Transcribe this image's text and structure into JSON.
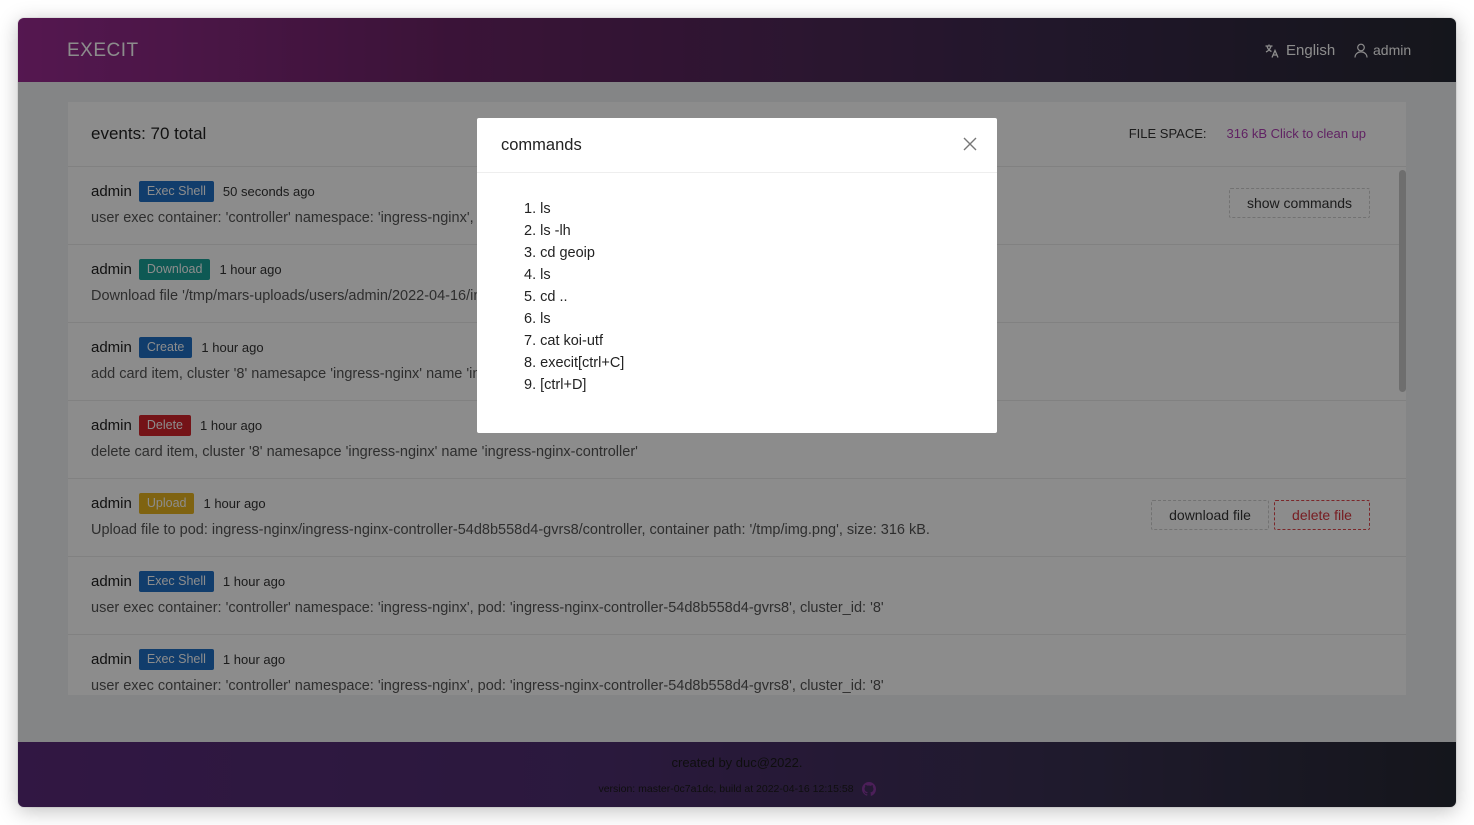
{
  "header": {
    "logo": "EXECIT",
    "language": "English",
    "user": "admin"
  },
  "events_card": {
    "title": "events: 70 total",
    "file_space_label": "FILE SPACE:",
    "file_space_value": "316 kB Click to clean up"
  },
  "events": [
    {
      "user": "admin",
      "badge": "Exec Shell",
      "badge_color": "#1f6fc5",
      "time": "50 seconds ago",
      "desc": "user exec container: 'controller' namespace: 'ingress-nginx', pod:   'ingress-nginx-controller-54d8b558d4-gvrs8', cluster_id: '8'",
      "actions": [
        "show commands"
      ]
    },
    {
      "user": "admin",
      "badge": "Download",
      "badge_color": "#1aa39a",
      "time": "1 hour ago",
      "desc": "Download file '/tmp/mars-uploads/users/admin/2022-04-16/img.png'",
      "actions": []
    },
    {
      "user": "admin",
      "badge": "Create",
      "badge_color": "#1f6fc5",
      "time": "1 hour ago",
      "desc": "add card item, cluster '8' namesapce 'ingress-nginx' name 'ingress-nginx-controller'",
      "actions": []
    },
    {
      "user": "admin",
      "badge": "Delete",
      "badge_color": "#d3242b",
      "time": "1 hour ago",
      "desc": "delete card item, cluster '8' namesapce 'ingress-nginx' name 'ingress-nginx-controller'",
      "actions": []
    },
    {
      "user": "admin",
      "badge": "Upload",
      "badge_color": "#e8b51f",
      "time": "1 hour ago",
      "desc": "Upload file to pod: ingress-nginx/ingress-nginx-controller-54d8b558d4-gvrs8/controller, container path: '/tmp/img.png', size: 316 kB.",
      "actions": [
        "download file",
        "delete file"
      ]
    },
    {
      "user": "admin",
      "badge": "Exec Shell",
      "badge_color": "#1f6fc5",
      "time": "1 hour ago",
      "desc": "user exec container: 'controller' namespace: 'ingress-nginx', pod:   'ingress-nginx-controller-54d8b558d4-gvrs8', cluster_id: '8'",
      "actions": []
    },
    {
      "user": "admin",
      "badge": "Exec Shell",
      "badge_color": "#1f6fc5",
      "time": "1 hour ago",
      "desc": "user exec container: 'controller' namespace: 'ingress-nginx', pod:   'ingress-nginx-controller-54d8b558d4-gvrs8', cluster_id: '8'",
      "actions": []
    }
  ],
  "footer": {
    "created": "created by duc@2022.",
    "version": "version: master-0c7a1dc, build at 2022-04-16 12:15:58"
  },
  "modal": {
    "title": "commands",
    "commands": [
      "ls",
      "ls -lh",
      "cd geoip",
      "ls",
      "cd ..",
      "ls",
      "cat koi-utf",
      "execit[ctrl+C]",
      "[ctrl+D]"
    ]
  }
}
